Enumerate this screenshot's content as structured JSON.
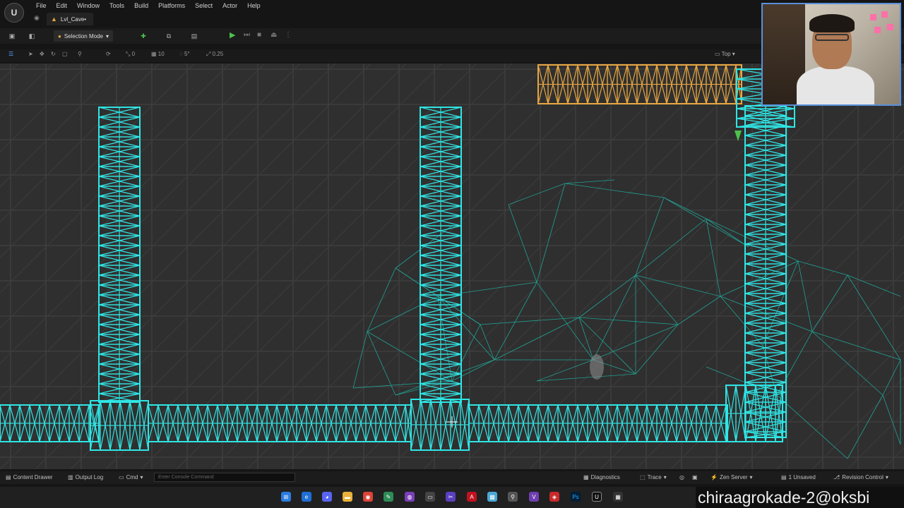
{
  "menu": {
    "items": [
      "File",
      "Edit",
      "Window",
      "Tools",
      "Build",
      "Platforms",
      "Select",
      "Actor",
      "Help"
    ]
  },
  "tab": {
    "title": "Lvl_Cave•"
  },
  "toolbar": {
    "mode_label": "Selection Mode",
    "icons": [
      "save-icon",
      "content-icon",
      "add-actor-icon",
      "blueprint-icon",
      "cinematics-icon",
      "play-icon"
    ]
  },
  "viewport": {
    "snap_rotation": "10",
    "snap_grid_angle": "5°",
    "snap_scale": "0.25",
    "snap_zero": "0",
    "view_mode": "Top",
    "colors": {
      "background": "#2f2f2f",
      "grid": "#444444",
      "wire_selected": "#30e5e5",
      "wire_mesh": "#1fb5a5",
      "wire_orange": "#e8a640"
    }
  },
  "status": {
    "content_drawer": "Content Drawer",
    "output_log": "Output Log",
    "cmd": "Cmd",
    "console_placeholder": "Enter Console Command",
    "diagnostics": "Diagnostics",
    "trace": "Trace",
    "zen_server": "Zen Server",
    "unsaved": "1 Unsaved",
    "revision_control": "Revision Control"
  },
  "watermark": {
    "text": "chiraagrokade-2@oksbi"
  }
}
